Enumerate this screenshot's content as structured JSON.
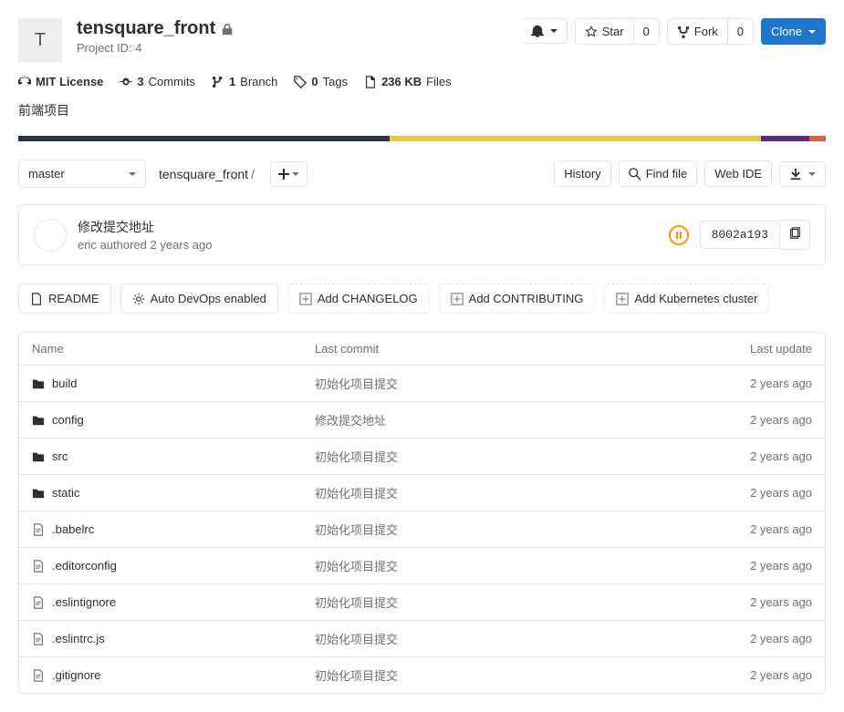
{
  "header": {
    "avatar_letter": "T",
    "title": "tensquare_front",
    "project_id_label": "Project ID: 4",
    "star_label": "Star",
    "star_count": "0",
    "fork_label": "Fork",
    "fork_count": "0",
    "clone_label": "Clone"
  },
  "stats": {
    "license": "MIT License",
    "commits_count": "3",
    "commits_label": "Commits",
    "branches_count": "1",
    "branches_label": "Branch",
    "tags_count": "0",
    "tags_label": "Tags",
    "size_count": "236 KB",
    "size_label": "Files"
  },
  "description": "前端项目",
  "lang_bar": [
    {
      "color": "#2e3440",
      "width": "46%"
    },
    {
      "color": "#e7c93f",
      "width": "46%"
    },
    {
      "color": "#5b2a84",
      "width": "6%"
    },
    {
      "color": "#e05d44",
      "width": "2%"
    }
  ],
  "file_nav": {
    "branch": "master",
    "breadcrumb": "tensquare_front",
    "history_label": "History",
    "find_file_label": "Find file",
    "web_ide_label": "Web IDE"
  },
  "commit": {
    "title": "修改提交地址",
    "author": "eric",
    "authored": "authored",
    "time": "2 years ago",
    "sha": "8002a193"
  },
  "quick_actions": {
    "readme": "README",
    "auto_devops": "Auto DevOps enabled",
    "add_changelog": "Add CHANGELOG",
    "add_contributing": "Add CONTRIBUTING",
    "add_k8s": "Add Kubernetes cluster"
  },
  "table": {
    "headers": {
      "name": "Name",
      "commit": "Last commit",
      "update": "Last update"
    },
    "rows": [
      {
        "type": "folder",
        "name": "build",
        "commit": "初始化项目提交",
        "update": "2 years ago"
      },
      {
        "type": "folder",
        "name": "config",
        "commit": "修改提交地址",
        "update": "2 years ago"
      },
      {
        "type": "folder",
        "name": "src",
        "commit": "初始化项目提交",
        "update": "2 years ago"
      },
      {
        "type": "folder",
        "name": "static",
        "commit": "初始化项目提交",
        "update": "2 years ago"
      },
      {
        "type": "file",
        "name": ".babelrc",
        "commit": "初始化项目提交",
        "update": "2 years ago"
      },
      {
        "type": "file",
        "name": ".editorconfig",
        "commit": "初始化项目提交",
        "update": "2 years ago"
      },
      {
        "type": "file",
        "name": ".eslintignore",
        "commit": "初始化项目提交",
        "update": "2 years ago"
      },
      {
        "type": "file",
        "name": ".eslintrc.js",
        "commit": "初始化项目提交",
        "update": "2 years ago"
      },
      {
        "type": "file",
        "name": ".gitignore",
        "commit": "初始化项目提交",
        "update": "2 years ago"
      }
    ]
  }
}
